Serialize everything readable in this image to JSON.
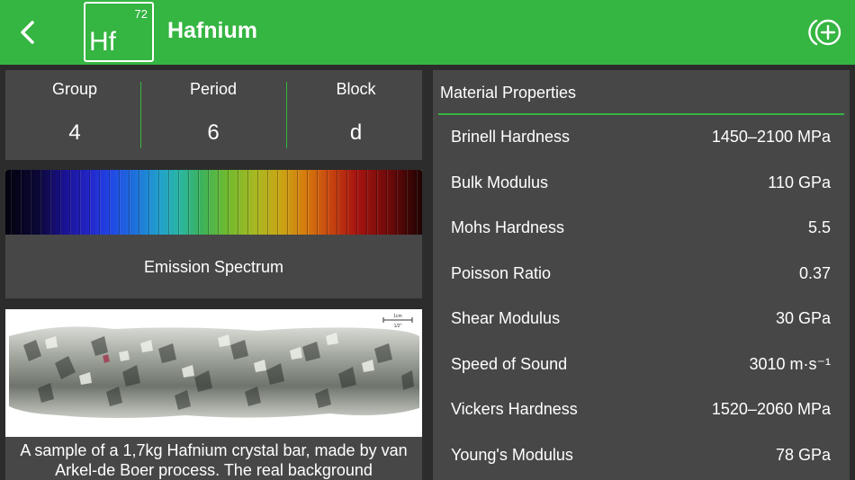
{
  "header": {
    "element_number": "72",
    "element_symbol": "Hf",
    "element_name": "Hafnium",
    "back_icon": "chevron-left-icon",
    "add_icon": "add-circle-icon",
    "accent_color": "#35b542"
  },
  "classification": {
    "columns": [
      {
        "label": "Group",
        "value": "4"
      },
      {
        "label": "Period",
        "value": "6"
      },
      {
        "label": "Block",
        "value": "d"
      }
    ]
  },
  "spectrum": {
    "caption": "Emission Spectrum"
  },
  "sample": {
    "caption": "A sample of a 1,7kg Hafnium crystal bar, made by van Arkel-de Boer process. The real background",
    "scale_top": "1cm",
    "scale_bottom": "1/2\""
  },
  "material_properties": {
    "title": "Material Properties",
    "rows": [
      {
        "name": "Brinell Hardness",
        "value": "1450–2100 MPa"
      },
      {
        "name": "Bulk Modulus",
        "value": "110 GPa"
      },
      {
        "name": "Mohs Hardness",
        "value": "5.5"
      },
      {
        "name": "Poisson Ratio",
        "value": "0.37"
      },
      {
        "name": "Shear Modulus",
        "value": "30 GPa"
      },
      {
        "name": "Speed of Sound",
        "value": "3010 m·s⁻¹"
      },
      {
        "name": "Vickers Hardness",
        "value": "1520–2060 MPa"
      },
      {
        "name": "Young's Modulus",
        "value": "78 GPa"
      }
    ]
  }
}
